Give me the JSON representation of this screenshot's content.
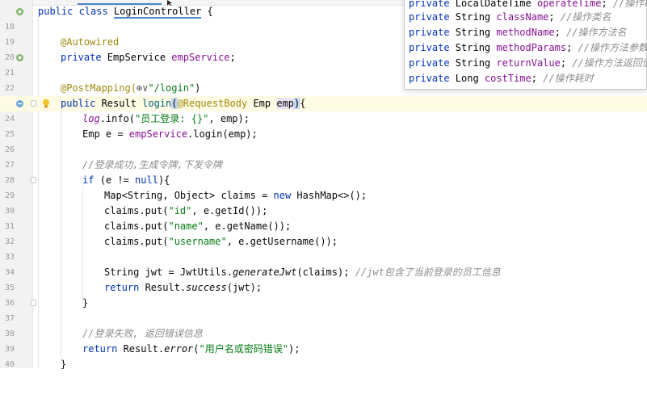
{
  "editor": {
    "colors": {
      "keyword": "#0033b3",
      "string": "#067d17",
      "annotation": "#9e880d",
      "field": "#871094",
      "comment": "#8c8c8c",
      "current_line": "#fdfbe3"
    },
    "lines": {
      "l18": {
        "num": "18",
        "kw1": "public class ",
        "cls": "LoginController",
        "rest": " {"
      },
      "l19": {
        "num": "19"
      },
      "l20": {
        "num": "20",
        "ann": "@Autowired"
      },
      "l21": {
        "num": "21",
        "kw": "private ",
        "type": "EmpService ",
        "field": "empService",
        "end": ";"
      },
      "l22": {
        "num": "22"
      },
      "l23": {
        "num": "23",
        "ann": "@PostMapping(",
        "globe": "⊕∨",
        "str": "\"/login\"",
        "end": ")"
      },
      "l24": {
        "num": "24",
        "kw": "public ",
        "t1": "Result ",
        "m": "login",
        "p1": "(",
        "ann": "@RequestBody ",
        "t2": "Emp ",
        "param": "emp",
        "p2": ")",
        "end": "{"
      },
      "l25": {
        "num": "25",
        "log": "log",
        "a": ".info(",
        "str": "\"员工登录: {}\"",
        "b": ", emp);"
      },
      "l26": {
        "num": "26",
        "a": "Emp e = ",
        "fld": "empService",
        "b": ".login(emp);"
      },
      "l27": {
        "num": "27"
      },
      "l28": {
        "num": "28",
        "cmt": "//登录成功,生成令牌,下发令牌"
      },
      "l29": {
        "num": "29",
        "kw": "if ",
        "a": "(e != ",
        "kw2": "null",
        "b": "){"
      },
      "l30": {
        "num": "30",
        "a": "Map<String, Object> claims = ",
        "kw": "new ",
        "b": "HashMap<>();"
      },
      "l31": {
        "num": "31",
        "a": "claims.put(",
        "str": "\"id\"",
        "b": ", e.getId());"
      },
      "l32": {
        "num": "32",
        "a": "claims.put(",
        "str": "\"name\"",
        "b": ", e.getName());"
      },
      "l33": {
        "num": "33",
        "a": "claims.put(",
        "str": "\"username\"",
        "b": ", e.getUsername());"
      },
      "l34": {
        "num": "34"
      },
      "l35": {
        "num": "35",
        "a": "String jwt = JwtUtils.",
        "it": "generateJwt",
        "b": "(claims); ",
        "cmt": "//jwt包含了当前登录的员工信息"
      },
      "l36": {
        "num": "36",
        "kw": "return ",
        "a": "Result.",
        "it": "success",
        "b": "(jwt);"
      },
      "l37": {
        "num": "37",
        "a": "}"
      },
      "l38": {
        "num": "38"
      },
      "l39": {
        "num": "39",
        "cmt": "//登录失败, 返回错误信息"
      },
      "l40": {
        "num": "40",
        "kw": "return ",
        "a": "Result.",
        "it": "error",
        "b": "(",
        "str": "\"用户名或密码错误\"",
        "c": ");"
      },
      "l41": {
        "a": "}"
      }
    }
  },
  "popup": {
    "rows": [
      {
        "kw": "private ",
        "type": "LocalDateTime ",
        "field": "operateTime",
        "end": "; ",
        "cmt": "//操作时间"
      },
      {
        "kw": "private ",
        "type": "String ",
        "field": "className",
        "end": "; ",
        "cmt": "//操作类名"
      },
      {
        "kw": "private ",
        "type": "String ",
        "field": "methodName",
        "end": "; ",
        "cmt": "//操作方法名"
      },
      {
        "kw": "private ",
        "type": "String ",
        "field": "methodParams",
        "end": "; ",
        "cmt": "//操作方法参数"
      },
      {
        "kw": "private ",
        "type": "String ",
        "field": "returnValue",
        "end": "; ",
        "cmt": "//操作方法返回值"
      },
      {
        "kw": "private ",
        "type": "Long ",
        "field": "costTime",
        "end": "; ",
        "cmt": "//操作耗时"
      }
    ]
  }
}
